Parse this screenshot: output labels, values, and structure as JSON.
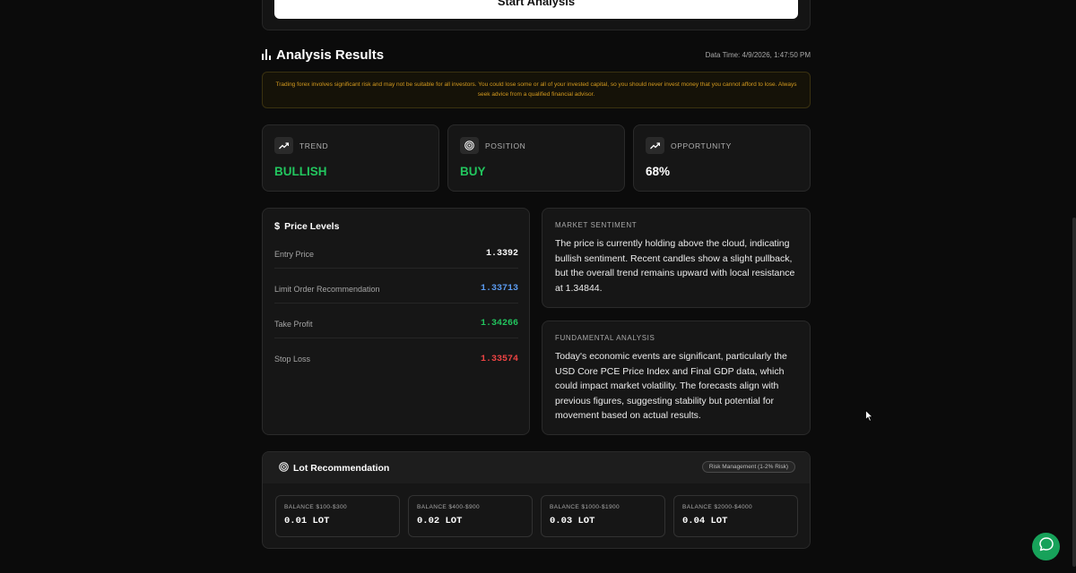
{
  "top": {
    "start_button_label": "Start Analysis"
  },
  "results": {
    "title": "Analysis Results",
    "data_time": "Data Time: 4/9/2026, 1:47:50 PM",
    "disclaimer": "Trading forex involves significant risk and may not be suitable for all investors. You could lose some or all of your invested capital, so you should never invest money that you cannot afford to lose. Always seek advice from a qualified financial advisor."
  },
  "stats": [
    {
      "label": "TREND",
      "value": "BULLISH",
      "icon": "trending-up-icon",
      "color": "#22c55e"
    },
    {
      "label": "POSITION",
      "value": "BUY",
      "icon": "target-icon",
      "color": "#22c55e"
    },
    {
      "label": "OPPORTUNITY",
      "value": "68%",
      "icon": "trending-up-icon",
      "color": "#ffffff"
    }
  ],
  "price_levels": {
    "title": "Price Levels",
    "rows": [
      {
        "label": "Entry Price",
        "value": "1.3392",
        "color": "#ffffff"
      },
      {
        "label": "Limit Order Recommendation",
        "value": "1.33713",
        "color": "#5b9bf0"
      },
      {
        "label": "Take Profit",
        "value": "1.34266",
        "color": "#22c55e"
      },
      {
        "label": "Stop Loss",
        "value": "1.33574",
        "color": "#ef4444"
      }
    ]
  },
  "market_sentiment": {
    "label": "MARKET SENTIMENT",
    "text": "The price is currently holding above the cloud, indicating bullish sentiment. Recent candles show a slight pullback, but the overall trend remains upward with local resistance at 1.34844."
  },
  "fundamental_analysis": {
    "label": "FUNDAMENTAL ANALYSIS",
    "text": "Today's economic events are significant, particularly the USD Core PCE Price Index and Final GDP data, which could impact market volatility. The forecasts align with previous figures, suggesting stability but potential for movement based on actual results."
  },
  "lot": {
    "title": "Lot Recommendation",
    "badge": "Risk Management (1-2% Risk)",
    "items": [
      {
        "range": "BALANCE $100-$300",
        "value": "0.01 LOT"
      },
      {
        "range": "BALANCE $400-$900",
        "value": "0.02 LOT"
      },
      {
        "range": "BALANCE $1000-$1900",
        "value": "0.03 LOT"
      },
      {
        "range": "BALANCE $2000-$4000",
        "value": "0.04 LOT"
      }
    ]
  },
  "colors": {
    "accent_green": "#22c55e",
    "chat_green": "#17a25a",
    "warning": "#d49a1e"
  }
}
